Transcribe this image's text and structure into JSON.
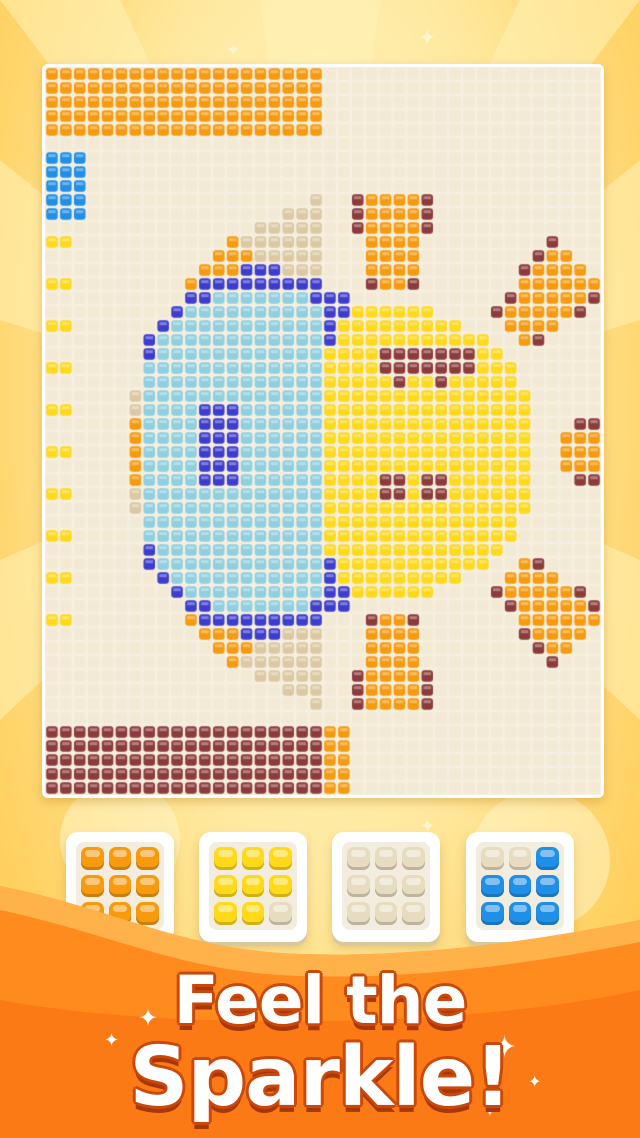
{
  "headline": {
    "line1": "Feel the",
    "line2": "Sparkle!"
  },
  "colors": {
    "orange": "#f79a0e",
    "yellow": "#ffd91a",
    "cream": "#e8dcc0",
    "blue": "#1f8fe8",
    "brown": "#8c3b3b",
    "royal": "#3c3ccf",
    "cyan": "#29c6d6",
    "lightblue": "#8ecfe0"
  },
  "trays": [
    {
      "name": "orange",
      "pegs": [
        "orange",
        "orange",
        "orange",
        "orange",
        "orange",
        "orange",
        "orange",
        "orange",
        "orange"
      ]
    },
    {
      "name": "yellow",
      "pegs": [
        "yellow",
        "yellow",
        "yellow",
        "yellow",
        "yellow",
        "yellow",
        "yellow",
        "yellow",
        "cream"
      ]
    },
    {
      "name": "cream",
      "pegs": [
        "cream",
        "cream",
        "cream",
        "cream",
        "cream",
        "cream",
        "cream",
        "cream",
        "cream"
      ]
    },
    {
      "name": "blue",
      "pegs": [
        "cream",
        "cream",
        "blue",
        "blue",
        "blue",
        "blue",
        "blue",
        "blue",
        "blue"
      ]
    }
  ]
}
